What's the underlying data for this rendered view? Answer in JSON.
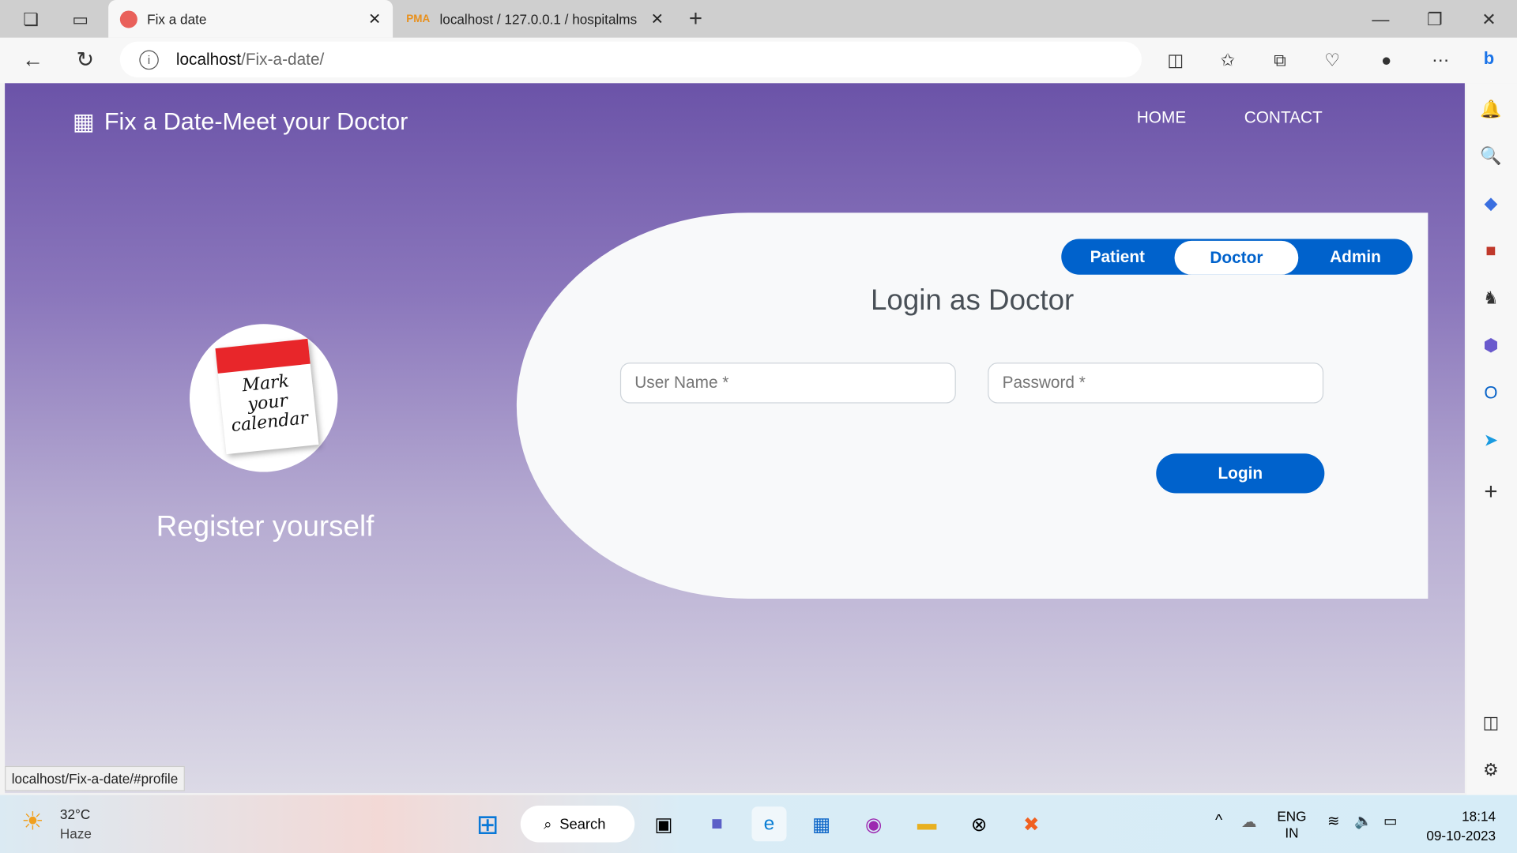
{
  "browser": {
    "tabs": [
      {
        "label": "Fix a date",
        "active": true
      },
      {
        "label": "localhost / 127.0.0.1 / hospitalms",
        "active": false
      }
    ],
    "url_host": "localhost",
    "url_path": "/Fix-a-date/",
    "status_url": "localhost/Fix-a-date/#profile"
  },
  "header": {
    "brand": "Fix a Date-Meet your Doctor",
    "nav": [
      "HOME",
      "CONTACT"
    ]
  },
  "left": {
    "calendar_text": "Mark your calendar",
    "register": "Register yourself"
  },
  "login": {
    "roles": [
      "Patient",
      "Doctor",
      "Admin"
    ],
    "active_role": "Doctor",
    "title": "Login as Doctor",
    "username_placeholder": "User Name *",
    "password_placeholder": "Password *",
    "button": "Login"
  },
  "taskbar": {
    "weather_temp": "32°C",
    "weather_desc": "Haze",
    "search": "Search",
    "lang": "ENG",
    "region": "IN",
    "time": "18:14",
    "date": "09-10-2023"
  },
  "colors": {
    "accent": "#0062cc",
    "purple": "#6b53a8"
  }
}
